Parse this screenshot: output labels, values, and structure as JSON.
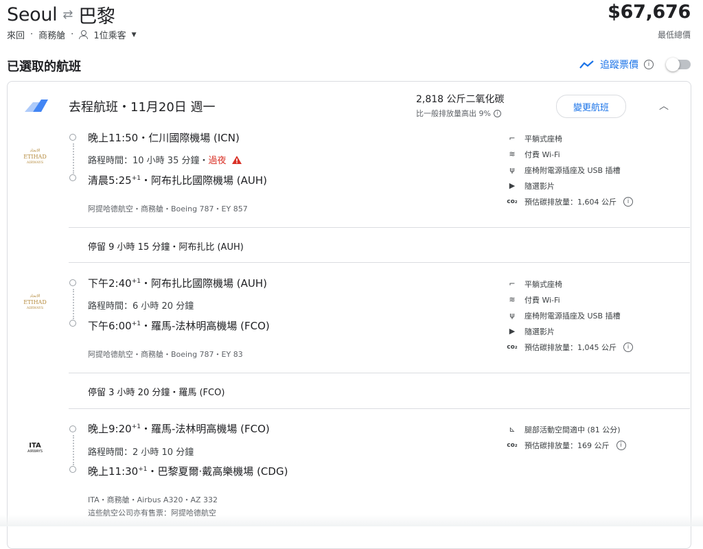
{
  "header": {
    "origin": "Seoul",
    "swap_icon": "⇄",
    "destination": "巴黎",
    "trip_type": "來回",
    "cabin": "商務艙",
    "passengers": "1位乘客",
    "price": "$67,676",
    "price_label": "最低總價"
  },
  "section_title": "已選取的航班",
  "track": {
    "label": "追蹤票價",
    "enabled": false
  },
  "card": {
    "title": "去程航班・11月20日 週一",
    "co2_total": "2,818 公斤二氧化碳",
    "co2_compare": "比一般排放量高出 9%",
    "change_button": "變更航班"
  },
  "legs": [
    {
      "airline_logo": "ETIHAD",
      "logo_sub": "AIRWAYS",
      "depart_time": "晚上11:50",
      "depart_plus": "",
      "depart_airport": "仁川國際機場 (ICN)",
      "duration": "路程時間：10 小時 35 分鐘",
      "overnight": "過夜",
      "arrive_time": "清晨5:25",
      "arrive_plus": "+1",
      "arrive_airport": "阿布扎比國際機場 (AUH)",
      "meta": "阿提哈德航空・商務艙・Boeing 787・EY 857",
      "meta2": "",
      "amenities": [
        {
          "icon": "flat-seat-icon",
          "glyph": "⌐",
          "label": "平躺式座椅"
        },
        {
          "icon": "wifi-icon",
          "glyph": "≋",
          "label": "付費 Wi-Fi"
        },
        {
          "icon": "power-plug-icon",
          "glyph": "ψ",
          "label": "座椅附電源插座及 USB 插槽"
        },
        {
          "icon": "video-icon",
          "glyph": "▶",
          "label": "隨選影片"
        },
        {
          "icon": "co2-icon",
          "glyph": "co₂",
          "label": "預估碳排放量：1,604 公斤"
        }
      ]
    },
    {
      "airline_logo": "ETIHAD",
      "logo_sub": "AIRWAYS",
      "depart_time": "下午2:40",
      "depart_plus": "+1",
      "depart_airport": "阿布扎比國際機場 (AUH)",
      "duration": "路程時間：6 小時 20 分鐘",
      "overnight": "",
      "arrive_time": "下午6:00",
      "arrive_plus": "+1",
      "arrive_airport": "羅馬-法林明高機場 (FCO)",
      "meta": "阿提哈德航空・商務艙・Boeing 787・EY 83",
      "meta2": "",
      "amenities": [
        {
          "icon": "flat-seat-icon",
          "glyph": "⌐",
          "label": "平躺式座椅"
        },
        {
          "icon": "wifi-icon",
          "glyph": "≋",
          "label": "付費 Wi-Fi"
        },
        {
          "icon": "power-plug-icon",
          "glyph": "ψ",
          "label": "座椅附電源插座及 USB 插槽"
        },
        {
          "icon": "video-icon",
          "glyph": "▶",
          "label": "隨選影片"
        },
        {
          "icon": "co2-icon",
          "glyph": "co₂",
          "label": "預估碳排放量：1,045 公斤"
        }
      ]
    },
    {
      "airline_logo": "ITA",
      "logo_sub": "AIRWAYS",
      "depart_time": "晚上9:20",
      "depart_plus": "+1",
      "depart_airport": "羅馬-法林明高機場 (FCO)",
      "duration": "路程時間：2 小時 10 分鐘",
      "overnight": "",
      "arrive_time": "晚上11:30",
      "arrive_plus": "+1",
      "arrive_airport": "巴黎夏爾·戴高樂機場 (CDG)",
      "meta": "ITA・商務艙・Airbus A320・AZ 332",
      "meta2": "這些航空公司亦有售票：阿提哈德航空",
      "amenities": [
        {
          "icon": "legroom-icon",
          "glyph": "⊾",
          "label": "腿部活動空間適中 (81 公分)"
        },
        {
          "icon": "co2-icon",
          "glyph": "co₂",
          "label": "預估碳排放量：169 公斤"
        }
      ]
    }
  ],
  "layovers": [
    "停留 9 小時 15 分鐘・阿布扎比 (AUH)",
    "停留 3 小時 20 分鐘・羅馬 (FCO)"
  ]
}
